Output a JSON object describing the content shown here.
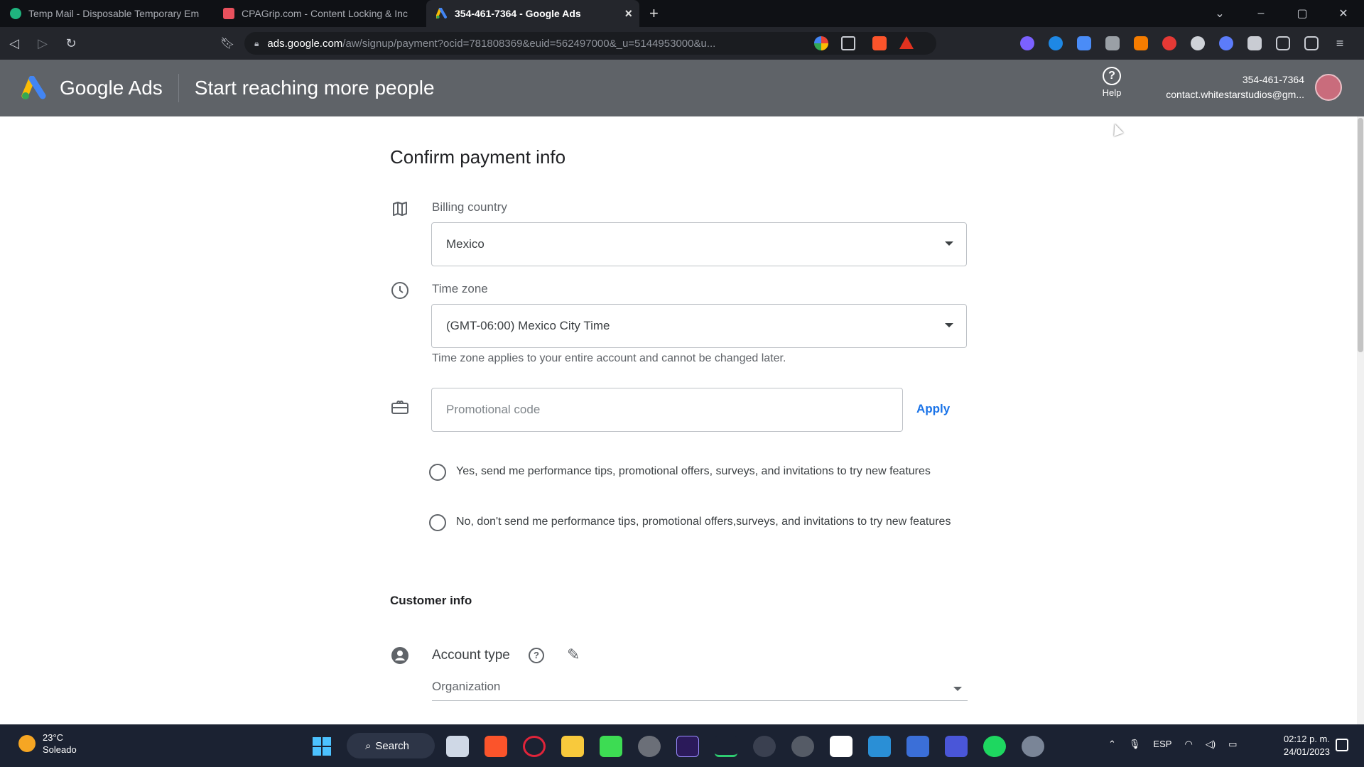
{
  "browser": {
    "tabs": [
      {
        "title": "Temp Mail - Disposable Temporary Em",
        "active": false,
        "icon": "tempmail-favicon"
      },
      {
        "title": "CPAGrip.com - Content Locking & Inc",
        "active": false,
        "icon": "cpagrip-favicon"
      },
      {
        "title": "354-461-7364 - Google Ads",
        "active": true,
        "icon": "google-ads-favicon"
      }
    ],
    "url_host": "ads.google.com",
    "url_path": "/aw/signup/payment?ocid=781808369&euid=562497000&_u=5144953000&u..."
  },
  "header": {
    "brand": "Google Ads",
    "headline": "Start reaching more people",
    "help_label": "Help",
    "account_id": "354-461-7364",
    "account_email": "contact.whitestarstudios@gm..."
  },
  "form": {
    "title": "Confirm payment info",
    "billing_country": {
      "label": "Billing country",
      "value": "Mexico"
    },
    "time_zone": {
      "label": "Time zone",
      "value": "(GMT-06:00) Mexico City Time",
      "helper": "Time zone applies to your entire account and cannot be changed later."
    },
    "promo": {
      "placeholder": "Promotional code",
      "apply_label": "Apply"
    },
    "radio_yes": "Yes, send me performance tips, promotional offers, surveys, and invitations to try new features",
    "radio_no": "No, don't send me performance tips, promotional offers,surveys, and invitations to try new features",
    "customer_info": {
      "section_title": "Customer info",
      "account_type_label": "Account type",
      "account_type_value": "Organization"
    }
  },
  "taskbar": {
    "temperature": "23°C",
    "weather": "Soleado",
    "search_label": "Search",
    "language": "ESP",
    "time": "02:12 p. m.",
    "date": "24/01/2023"
  },
  "colors": {
    "header_bg": "#5f6368",
    "accent": "#1a73e8",
    "taskbar_bg": "#1b2232"
  }
}
